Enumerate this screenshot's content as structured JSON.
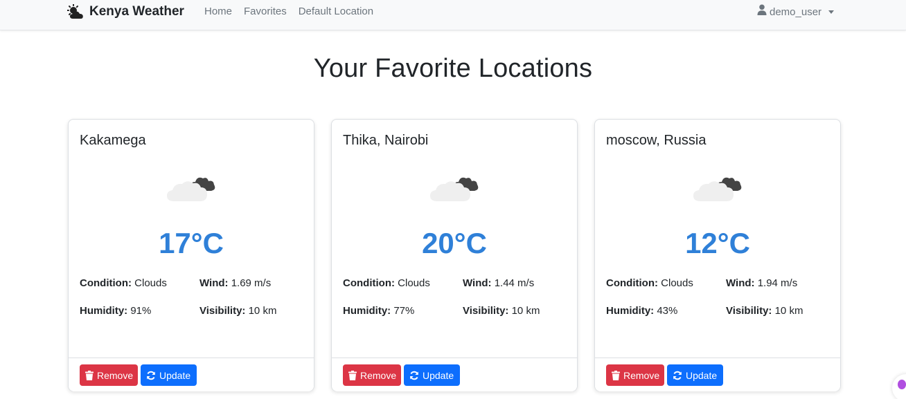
{
  "navbar": {
    "brand": "Kenya Weather",
    "links": [
      "Home",
      "Favorites",
      "Default Location"
    ],
    "user": "demo_user"
  },
  "page": {
    "title": "Your Favorite Locations"
  },
  "labels": {
    "condition": "Condition:",
    "wind": "Wind:",
    "humidity": "Humidity:",
    "visibility": "Visibility:",
    "remove": "Remove",
    "update": "Update"
  },
  "cards": [
    {
      "name": "Kakamega",
      "temp": "17°C",
      "condition": "Clouds",
      "wind": "1.69 m/s",
      "humidity": "91%",
      "visibility": "10 km",
      "icon": "clouds-icon"
    },
    {
      "name": "Thika, Nairobi",
      "temp": "20°C",
      "condition": "Clouds",
      "wind": "1.44 m/s",
      "humidity": "77%",
      "visibility": "10 km",
      "icon": "clouds-icon"
    },
    {
      "name": "moscow, Russia",
      "temp": "12°C",
      "condition": "Clouds",
      "wind": "1.94 m/s",
      "humidity": "43%",
      "visibility": "10 km",
      "icon": "clouds-icon"
    }
  ],
  "colors": {
    "temp": "#2f80d8",
    "remove_button": "#dc3545",
    "update_button": "#0d6efd"
  }
}
